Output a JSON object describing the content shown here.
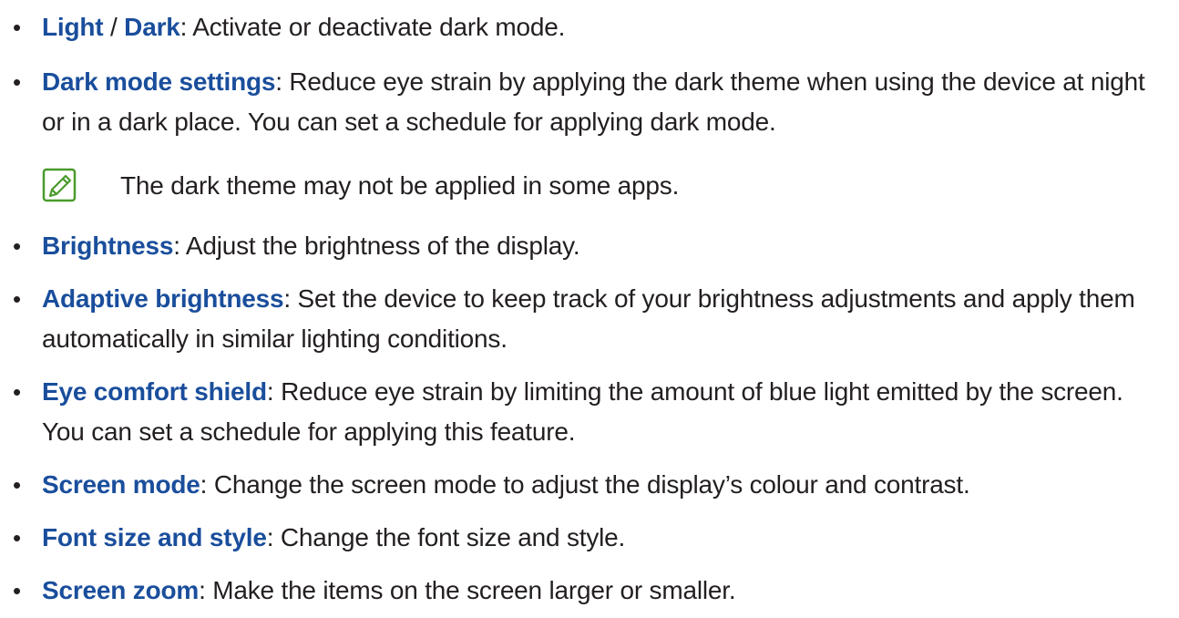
{
  "bullet_char": "•",
  "colors": {
    "term": "#1a4e9c",
    "body_text": "#231f20",
    "note_icon": "#4a9a2c"
  },
  "items": [
    {
      "term": "Light",
      "sep": " / ",
      "term2": "Dark",
      "desc": ": Activate or deactivate dark mode."
    },
    {
      "term": "Dark mode settings",
      "desc": ": Reduce eye strain by applying the dark theme when using the device at night or in a dark place. You can set a schedule for applying dark mode."
    },
    {
      "term": "Brightness",
      "desc": ": Adjust the brightness of the display."
    },
    {
      "term": "Adaptive brightness",
      "desc": ": Set the device to keep track of your brightness adjustments and apply them automatically in similar lighting conditions."
    },
    {
      "term": "Eye comfort shield",
      "desc": ": Reduce eye strain by limiting the amount of blue light emitted by the screen. You can set a schedule for applying this feature."
    },
    {
      "term": "Screen mode",
      "desc": ": Change the screen mode to adjust the display’s colour and contrast."
    },
    {
      "term": "Font size and style",
      "desc": ": Change the font size and style."
    },
    {
      "term": "Screen zoom",
      "desc": ": Make the items on the screen larger or smaller."
    }
  ],
  "note": {
    "icon": "note-pencil-icon",
    "text": "The dark theme may not be applied in some apps."
  }
}
